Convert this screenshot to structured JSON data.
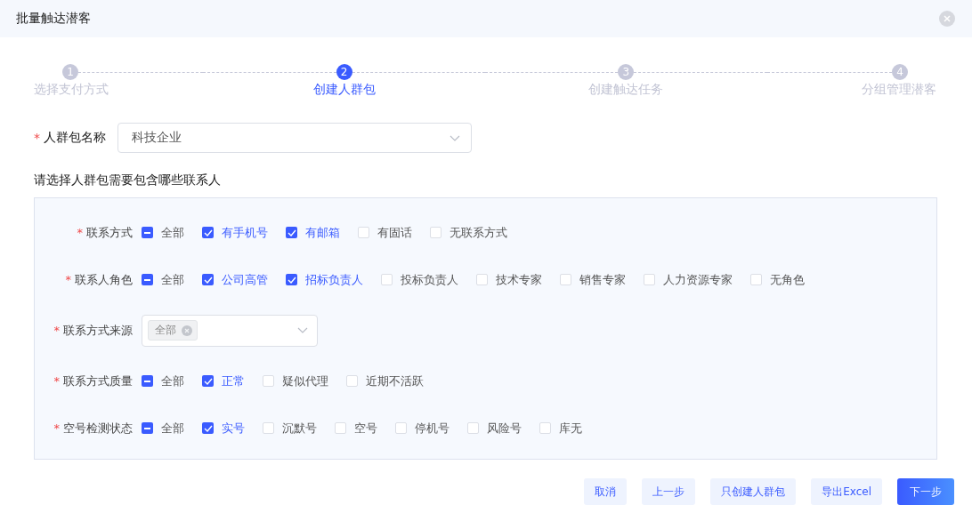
{
  "window": {
    "title": "批量触达潜客"
  },
  "steps": [
    {
      "number": "1",
      "label": "选择支付方式",
      "selected": false
    },
    {
      "number": "2",
      "label": "创建人群包",
      "selected": true
    },
    {
      "number": "3",
      "label": "创建触达任务",
      "selected": false
    },
    {
      "number": "4",
      "label": "分组管理潜客",
      "selected": false
    }
  ],
  "name_field": {
    "required_mark": "*",
    "label": "人群包名称",
    "value": "科技企业"
  },
  "section_title": "请选择人群包需要包含哪些联系人",
  "filters": [
    {
      "kind": "checkboxes",
      "required_mark": "*",
      "label": "联系方式",
      "options": [
        {
          "kind": "select_all",
          "label": "全部",
          "indeterminate": true
        },
        {
          "kind": "option",
          "label": "有手机号",
          "checked": true
        },
        {
          "kind": "option",
          "label": "有邮箱",
          "checked": true
        },
        {
          "kind": "option",
          "label": "有固话",
          "checked": false
        },
        {
          "kind": "option",
          "label": "无联系方式",
          "checked": false
        }
      ]
    },
    {
      "kind": "checkboxes",
      "required_mark": "*",
      "label": "联系人角色",
      "options": [
        {
          "kind": "select_all",
          "label": "全部",
          "indeterminate": true
        },
        {
          "kind": "option",
          "label": "公司高管",
          "checked": true
        },
        {
          "kind": "option",
          "label": "招标负责人",
          "checked": true
        },
        {
          "kind": "option",
          "label": "投标负责人",
          "checked": false
        },
        {
          "kind": "option",
          "label": "技术专家",
          "checked": false
        },
        {
          "kind": "option",
          "label": "销售专家",
          "checked": false
        },
        {
          "kind": "option",
          "label": "人力资源专家",
          "checked": false
        },
        {
          "kind": "option",
          "label": "无角色",
          "checked": false
        }
      ]
    },
    {
      "kind": "select",
      "required_mark": "*",
      "label": "联系方式来源",
      "tags": [
        "全部"
      ]
    },
    {
      "kind": "checkboxes",
      "required_mark": "*",
      "label": "联系方式质量",
      "options": [
        {
          "kind": "select_all",
          "label": "全部",
          "indeterminate": true
        },
        {
          "kind": "option",
          "label": "正常",
          "checked": true
        },
        {
          "kind": "option",
          "label": "疑似代理",
          "checked": false
        },
        {
          "kind": "option",
          "label": "近期不活跃",
          "checked": false
        }
      ]
    },
    {
      "kind": "checkboxes",
      "required_mark": "*",
      "label": "空号检测状态",
      "options": [
        {
          "kind": "select_all",
          "label": "全部",
          "indeterminate": true
        },
        {
          "kind": "option",
          "label": "实号",
          "checked": true
        },
        {
          "kind": "option",
          "label": "沉默号",
          "checked": false
        },
        {
          "kind": "option",
          "label": "空号",
          "checked": false
        },
        {
          "kind": "option",
          "label": "停机号",
          "checked": false
        },
        {
          "kind": "option",
          "label": "风险号",
          "checked": false
        },
        {
          "kind": "option",
          "label": "库无",
          "checked": false
        }
      ]
    }
  ],
  "buttons": [
    {
      "label": "取消",
      "kind": "secondary"
    },
    {
      "label": "上一步",
      "kind": "secondary"
    },
    {
      "label": "只创建人群包",
      "kind": "secondary"
    },
    {
      "label": "导出Excel",
      "kind": "secondary"
    },
    {
      "label": "下一步",
      "kind": "primary"
    }
  ]
}
